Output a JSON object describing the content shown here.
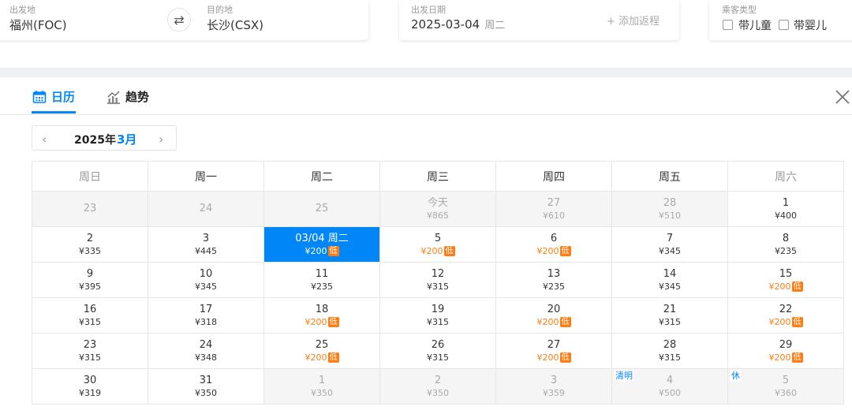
{
  "search": {
    "origin_label": "出发地",
    "origin_value": "福州(FOC)",
    "dest_label": "目的地",
    "dest_value": "长沙(CSX)",
    "date_label": "出发日期",
    "date_value": "2025-03-04",
    "date_weekday": "周二",
    "add_return": "+ 添加返程",
    "pax_label": "乘客类型",
    "child_label": "带儿童",
    "infant_label": "带婴儿"
  },
  "tabs": [
    {
      "label": "日历",
      "icon": "calendar-icon",
      "active": true
    },
    {
      "label": "趋势",
      "icon": "trend-chart-icon",
      "active": false
    }
  ],
  "month_nav": {
    "year": "2025年",
    "month": "3月"
  },
  "colors": {
    "accent": "#0086f6",
    "low_price": "#ff7d13"
  },
  "weekdays": [
    "周日",
    "周一",
    "周二",
    "周三",
    "周四",
    "周五",
    "周六"
  ],
  "weeks": [
    [
      {
        "day": "23",
        "price": "",
        "state": "past"
      },
      {
        "day": "24",
        "price": "",
        "state": "past"
      },
      {
        "day": "25",
        "price": "",
        "state": "past"
      },
      {
        "day": "今天",
        "price": "¥865",
        "state": "past"
      },
      {
        "day": "27",
        "price": "¥610",
        "state": "past"
      },
      {
        "day": "28",
        "price": "¥510",
        "state": "past"
      },
      {
        "day": "1",
        "price": "¥400",
        "state": "normal"
      }
    ],
    [
      {
        "day": "2",
        "price": "¥335",
        "state": "normal"
      },
      {
        "day": "3",
        "price": "¥445",
        "state": "normal"
      },
      {
        "day": "03/04 周二",
        "price": "¥200",
        "state": "selected",
        "low": true
      },
      {
        "day": "5",
        "price": "¥200",
        "state": "normal",
        "low": true
      },
      {
        "day": "6",
        "price": "¥200",
        "state": "normal",
        "low": true
      },
      {
        "day": "7",
        "price": "¥345",
        "state": "normal"
      },
      {
        "day": "8",
        "price": "¥235",
        "state": "normal"
      }
    ],
    [
      {
        "day": "9",
        "price": "¥395",
        "state": "normal"
      },
      {
        "day": "10",
        "price": "¥345",
        "state": "normal"
      },
      {
        "day": "11",
        "price": "¥235",
        "state": "normal"
      },
      {
        "day": "12",
        "price": "¥315",
        "state": "normal"
      },
      {
        "day": "13",
        "price": "¥235",
        "state": "normal"
      },
      {
        "day": "14",
        "price": "¥345",
        "state": "normal"
      },
      {
        "day": "15",
        "price": "¥200",
        "state": "normal",
        "low": true
      }
    ],
    [
      {
        "day": "16",
        "price": "¥315",
        "state": "normal"
      },
      {
        "day": "17",
        "price": "¥318",
        "state": "normal"
      },
      {
        "day": "18",
        "price": "¥200",
        "state": "normal",
        "low": true
      },
      {
        "day": "19",
        "price": "¥315",
        "state": "normal"
      },
      {
        "day": "20",
        "price": "¥200",
        "state": "normal",
        "low": true
      },
      {
        "day": "21",
        "price": "¥315",
        "state": "normal"
      },
      {
        "day": "22",
        "price": "¥200",
        "state": "normal",
        "low": true
      }
    ],
    [
      {
        "day": "23",
        "price": "¥315",
        "state": "normal"
      },
      {
        "day": "24",
        "price": "¥348",
        "state": "normal"
      },
      {
        "day": "25",
        "price": "¥200",
        "state": "normal",
        "low": true
      },
      {
        "day": "26",
        "price": "¥315",
        "state": "normal"
      },
      {
        "day": "27",
        "price": "¥200",
        "state": "normal",
        "low": true
      },
      {
        "day": "28",
        "price": "¥315",
        "state": "normal"
      },
      {
        "day": "29",
        "price": "¥200",
        "state": "normal",
        "low": true
      }
    ],
    [
      {
        "day": "30",
        "price": "¥319",
        "state": "normal"
      },
      {
        "day": "31",
        "price": "¥350",
        "state": "normal"
      },
      {
        "day": "1",
        "price": "¥350",
        "state": "past"
      },
      {
        "day": "2",
        "price": "¥350",
        "state": "past"
      },
      {
        "day": "3",
        "price": "¥359",
        "state": "past"
      },
      {
        "day": "4",
        "price": "¥500",
        "state": "past",
        "holiday": "清明"
      },
      {
        "day": "5",
        "price": "¥360",
        "state": "past",
        "holiday": "休"
      }
    ]
  ],
  "low_badge": "低"
}
